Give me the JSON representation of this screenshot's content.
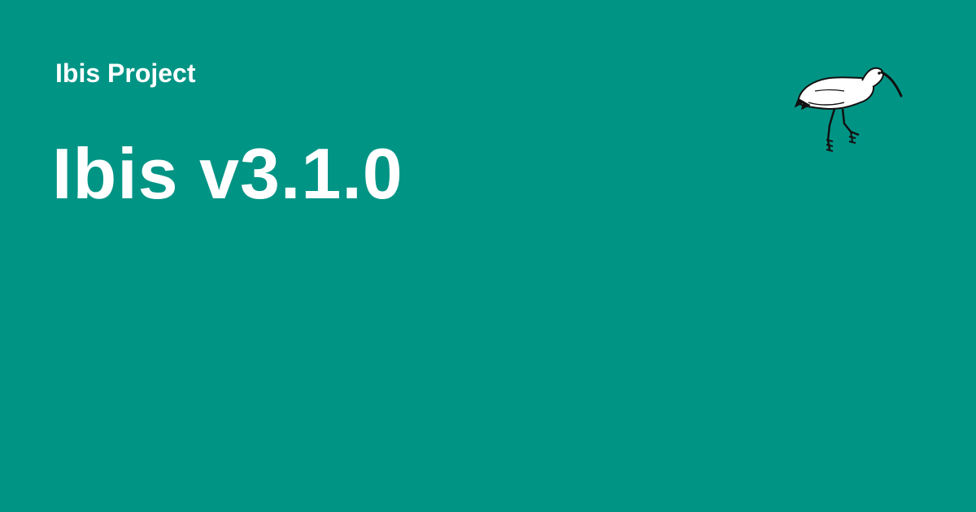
{
  "card": {
    "site_name": "Ibis Project",
    "title": "Ibis v3.1.0"
  },
  "logo": {
    "icon": "ibis-bird-icon"
  },
  "colors": {
    "background": "#009485",
    "text": "#ffffff",
    "ink": "#111111"
  }
}
